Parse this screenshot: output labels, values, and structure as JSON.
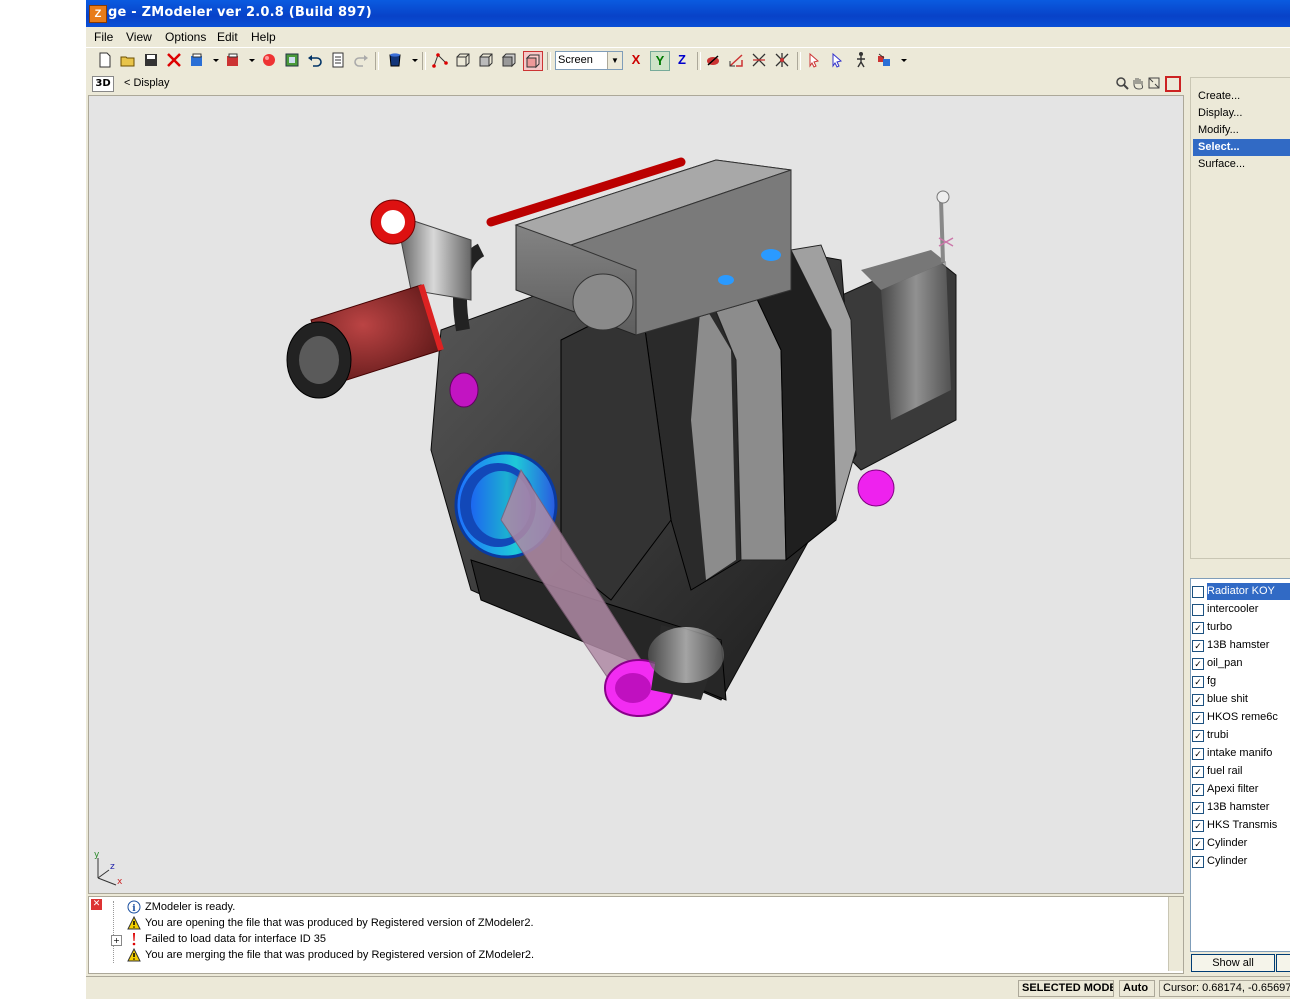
{
  "window": {
    "title": "ge - ZModeler ver 2.0.8 (Build 897)"
  },
  "menu": [
    "File",
    "View",
    "Options",
    "Edit",
    "Help"
  ],
  "toolbar": {
    "view_mode": "Screen",
    "axes": [
      "X",
      "Y",
      "Z"
    ],
    "colors": {
      "x": "#cc0000",
      "y": "#007a00",
      "z": "#0000cc"
    }
  },
  "viewport": {
    "mode_badge": "3D",
    "label": "< Display",
    "gizmo": {
      "y": "y",
      "z": "z",
      "x": "x"
    }
  },
  "command_menu": [
    {
      "label": "Create...",
      "selected": false
    },
    {
      "label": "Display...",
      "selected": false
    },
    {
      "label": "Modify...",
      "selected": false
    },
    {
      "label": "Select...",
      "selected": true
    },
    {
      "label": "Surface...",
      "selected": false
    }
  ],
  "objects": [
    {
      "name": "Radiator KOY",
      "checked": false
    },
    {
      "name": "intercooler",
      "checked": false
    },
    {
      "name": "turbo",
      "checked": true
    },
    {
      "name": "13B hamster",
      "checked": true
    },
    {
      "name": "oil_pan",
      "checked": true
    },
    {
      "name": "fg",
      "checked": true
    },
    {
      "name": "blue shit",
      "checked": true
    },
    {
      "name": "HKOS reme6c",
      "checked": true
    },
    {
      "name": "trubi",
      "checked": true
    },
    {
      "name": "intake manifo",
      "checked": true
    },
    {
      "name": "fuel rail",
      "checked": true
    },
    {
      "name": "Apexi filter",
      "checked": true
    },
    {
      "name": "13B hamster",
      "checked": true
    },
    {
      "name": "HKS Transmis",
      "checked": true
    },
    {
      "name": "Cylinder",
      "checked": true
    },
    {
      "name": "Cylinder",
      "checked": true
    }
  ],
  "show_all_label": "Show all",
  "log": [
    {
      "icon": "info-icon",
      "text": "ZModeler is ready."
    },
    {
      "icon": "warning-icon",
      "text": "You are opening the file that was produced by Registered version of ZModeler2."
    },
    {
      "icon": "error-icon",
      "text": "Failed to load data for interface ID 35"
    },
    {
      "icon": "warning-icon",
      "text": "You are merging the file that was produced by Registered version of ZModeler2."
    }
  ],
  "status": {
    "mode": "SELECTED MODE",
    "auto": "Auto",
    "cursor": "Cursor: 0.68174, -0.65697"
  }
}
